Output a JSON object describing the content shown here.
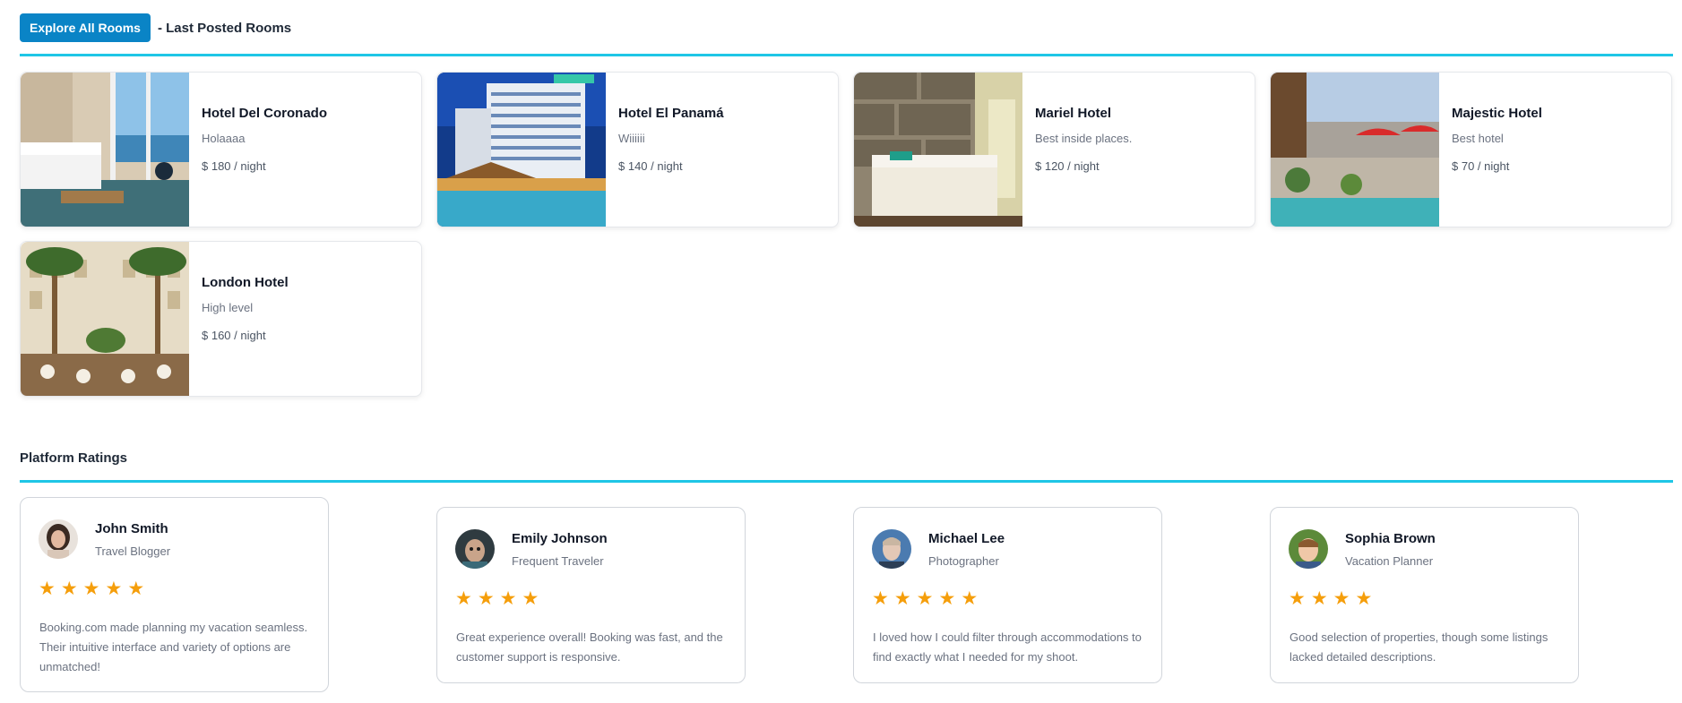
{
  "rooms_section": {
    "explore_button": "Explore All Rooms",
    "subtitle": "- Last Posted Rooms",
    "accent": "#1fc6e6",
    "button_color": "#0a84c6"
  },
  "rooms": [
    {
      "name": "Hotel Del Coronado",
      "description": "Holaaaa",
      "price": "$ 180 / night"
    },
    {
      "name": "Hotel El Panamá",
      "description": "Wiiiiii",
      "price": "$ 140 / night"
    },
    {
      "name": "Mariel Hotel",
      "description": "Best inside places.",
      "price": "$ 120 / night"
    },
    {
      "name": "Majestic Hotel",
      "description": "Best hotel",
      "price": "$ 70 / night"
    },
    {
      "name": "London Hotel",
      "description": "High level",
      "price": "$ 160 / night"
    }
  ],
  "ratings_section": {
    "title": "Platform Ratings",
    "star_color": "#f59e0b"
  },
  "reviews": [
    {
      "name": "John Smith",
      "role": "Travel Blogger",
      "stars": 5,
      "text": "Booking.com made planning my vacation seamless. Their intuitive interface and variety of options are unmatched!"
    },
    {
      "name": "Emily Johnson",
      "role": "Frequent Traveler",
      "stars": 4,
      "text": "Great experience overall! Booking was fast, and the customer support is responsive."
    },
    {
      "name": "Michael Lee",
      "role": "Photographer",
      "stars": 5,
      "text": "I loved how I could filter through accommodations to find exactly what I needed for my shoot."
    },
    {
      "name": "Sophia Brown",
      "role": "Vacation Planner",
      "stars": 4,
      "text": "Good selection of properties, though some listings lacked detailed descriptions."
    }
  ]
}
